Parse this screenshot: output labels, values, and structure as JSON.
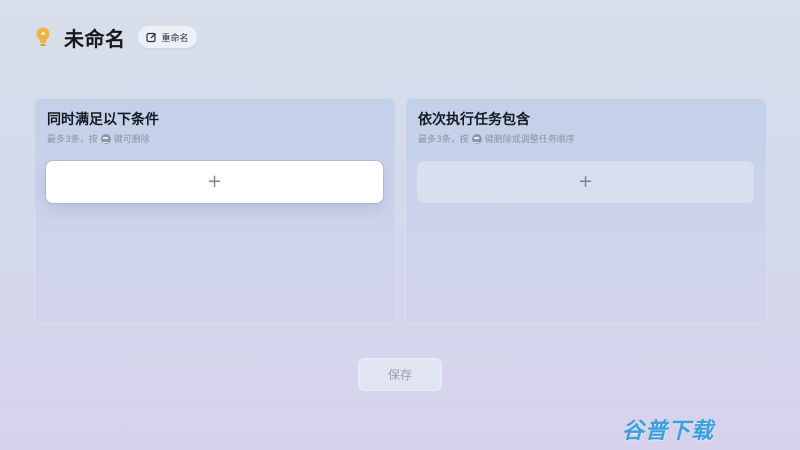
{
  "header": {
    "title": "未命名",
    "rename_label": "重命名",
    "icon": "lightbulb-icon",
    "icon_color": "#f2b441"
  },
  "panels": {
    "conditions": {
      "title": "同时满足以下条件",
      "hint_before": "最多3条，按",
      "hint_after": "键可删除",
      "add_symbol": "+"
    },
    "tasks": {
      "title": "依次执行任务包含",
      "hint_before": "最多3条，按",
      "hint_after": "键删除或调整任务顺序",
      "add_symbol": "+"
    }
  },
  "footer": {
    "save_label": "保存"
  },
  "watermark": {
    "text": "谷普下载",
    "color": "#3aa0de"
  }
}
